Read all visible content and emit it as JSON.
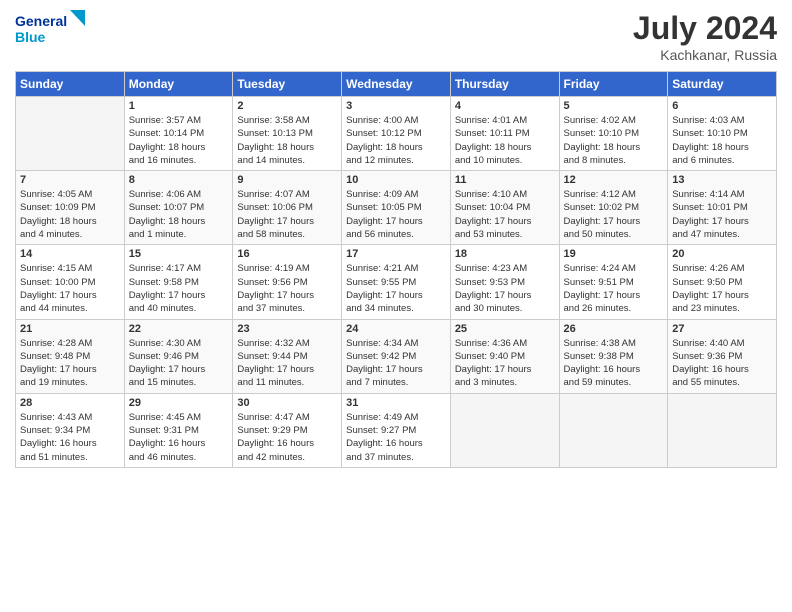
{
  "header": {
    "logo_general": "General",
    "logo_blue": "Blue",
    "title": "July 2024",
    "location": "Kachkanar, Russia"
  },
  "weekdays": [
    "Sunday",
    "Monday",
    "Tuesday",
    "Wednesday",
    "Thursday",
    "Friday",
    "Saturday"
  ],
  "weeks": [
    [
      {
        "day": "",
        "info": ""
      },
      {
        "day": "1",
        "info": "Sunrise: 3:57 AM\nSunset: 10:14 PM\nDaylight: 18 hours\nand 16 minutes."
      },
      {
        "day": "2",
        "info": "Sunrise: 3:58 AM\nSunset: 10:13 PM\nDaylight: 18 hours\nand 14 minutes."
      },
      {
        "day": "3",
        "info": "Sunrise: 4:00 AM\nSunset: 10:12 PM\nDaylight: 18 hours\nand 12 minutes."
      },
      {
        "day": "4",
        "info": "Sunrise: 4:01 AM\nSunset: 10:11 PM\nDaylight: 18 hours\nand 10 minutes."
      },
      {
        "day": "5",
        "info": "Sunrise: 4:02 AM\nSunset: 10:10 PM\nDaylight: 18 hours\nand 8 minutes."
      },
      {
        "day": "6",
        "info": "Sunrise: 4:03 AM\nSunset: 10:10 PM\nDaylight: 18 hours\nand 6 minutes."
      }
    ],
    [
      {
        "day": "7",
        "info": "Sunrise: 4:05 AM\nSunset: 10:09 PM\nDaylight: 18 hours\nand 4 minutes."
      },
      {
        "day": "8",
        "info": "Sunrise: 4:06 AM\nSunset: 10:07 PM\nDaylight: 18 hours\nand 1 minute."
      },
      {
        "day": "9",
        "info": "Sunrise: 4:07 AM\nSunset: 10:06 PM\nDaylight: 17 hours\nand 58 minutes."
      },
      {
        "day": "10",
        "info": "Sunrise: 4:09 AM\nSunset: 10:05 PM\nDaylight: 17 hours\nand 56 minutes."
      },
      {
        "day": "11",
        "info": "Sunrise: 4:10 AM\nSunset: 10:04 PM\nDaylight: 17 hours\nand 53 minutes."
      },
      {
        "day": "12",
        "info": "Sunrise: 4:12 AM\nSunset: 10:02 PM\nDaylight: 17 hours\nand 50 minutes."
      },
      {
        "day": "13",
        "info": "Sunrise: 4:14 AM\nSunset: 10:01 PM\nDaylight: 17 hours\nand 47 minutes."
      }
    ],
    [
      {
        "day": "14",
        "info": "Sunrise: 4:15 AM\nSunset: 10:00 PM\nDaylight: 17 hours\nand 44 minutes."
      },
      {
        "day": "15",
        "info": "Sunrise: 4:17 AM\nSunset: 9:58 PM\nDaylight: 17 hours\nand 40 minutes."
      },
      {
        "day": "16",
        "info": "Sunrise: 4:19 AM\nSunset: 9:56 PM\nDaylight: 17 hours\nand 37 minutes."
      },
      {
        "day": "17",
        "info": "Sunrise: 4:21 AM\nSunset: 9:55 PM\nDaylight: 17 hours\nand 34 minutes."
      },
      {
        "day": "18",
        "info": "Sunrise: 4:23 AM\nSunset: 9:53 PM\nDaylight: 17 hours\nand 30 minutes."
      },
      {
        "day": "19",
        "info": "Sunrise: 4:24 AM\nSunset: 9:51 PM\nDaylight: 17 hours\nand 26 minutes."
      },
      {
        "day": "20",
        "info": "Sunrise: 4:26 AM\nSunset: 9:50 PM\nDaylight: 17 hours\nand 23 minutes."
      }
    ],
    [
      {
        "day": "21",
        "info": "Sunrise: 4:28 AM\nSunset: 9:48 PM\nDaylight: 17 hours\nand 19 minutes."
      },
      {
        "day": "22",
        "info": "Sunrise: 4:30 AM\nSunset: 9:46 PM\nDaylight: 17 hours\nand 15 minutes."
      },
      {
        "day": "23",
        "info": "Sunrise: 4:32 AM\nSunset: 9:44 PM\nDaylight: 17 hours\nand 11 minutes."
      },
      {
        "day": "24",
        "info": "Sunrise: 4:34 AM\nSunset: 9:42 PM\nDaylight: 17 hours\nand 7 minutes."
      },
      {
        "day": "25",
        "info": "Sunrise: 4:36 AM\nSunset: 9:40 PM\nDaylight: 17 hours\nand 3 minutes."
      },
      {
        "day": "26",
        "info": "Sunrise: 4:38 AM\nSunset: 9:38 PM\nDaylight: 16 hours\nand 59 minutes."
      },
      {
        "day": "27",
        "info": "Sunrise: 4:40 AM\nSunset: 9:36 PM\nDaylight: 16 hours\nand 55 minutes."
      }
    ],
    [
      {
        "day": "28",
        "info": "Sunrise: 4:43 AM\nSunset: 9:34 PM\nDaylight: 16 hours\nand 51 minutes."
      },
      {
        "day": "29",
        "info": "Sunrise: 4:45 AM\nSunset: 9:31 PM\nDaylight: 16 hours\nand 46 minutes."
      },
      {
        "day": "30",
        "info": "Sunrise: 4:47 AM\nSunset: 9:29 PM\nDaylight: 16 hours\nand 42 minutes."
      },
      {
        "day": "31",
        "info": "Sunrise: 4:49 AM\nSunset: 9:27 PM\nDaylight: 16 hours\nand 37 minutes."
      },
      {
        "day": "",
        "info": ""
      },
      {
        "day": "",
        "info": ""
      },
      {
        "day": "",
        "info": ""
      }
    ]
  ]
}
